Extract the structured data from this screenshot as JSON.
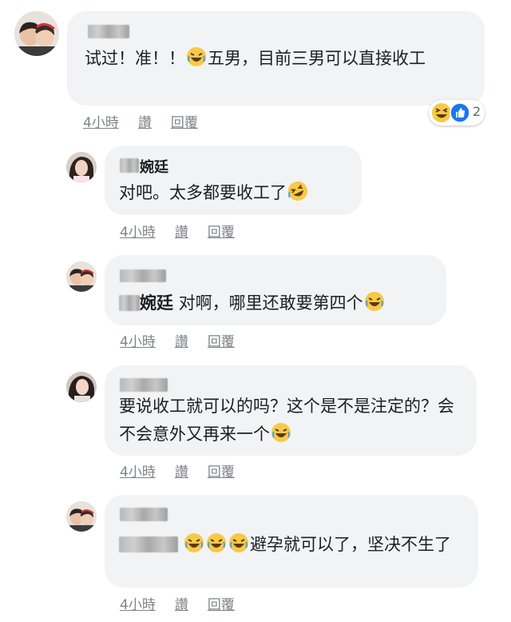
{
  "comments": [
    {
      "name_suffix": "",
      "text_a": "试过！准！！",
      "text_b": "五男，目前三男可以直接收工",
      "time": "4小時",
      "like": "讚",
      "reply": "回覆",
      "reaction_count": "2"
    },
    {
      "name_suffix": "婉廷",
      "text_a": "对吧。太多都要收工了",
      "time": "4小時",
      "like": "讚",
      "reply": "回覆"
    },
    {
      "name_suffix": "",
      "mention_suffix": "婉廷",
      "text_a": "对啊，哪里还敢要第四个",
      "time": "4小時",
      "like": "讚",
      "reply": "回覆"
    },
    {
      "name_suffix": "",
      "text_a": "要说收工就可以的吗？这个是不是注定的？会不会意外又再来一个",
      "time": "4小時",
      "like": "讚",
      "reply": "回覆"
    },
    {
      "name_suffix": "",
      "text_a": "避孕就可以了，坚决不生了",
      "time": "4小時",
      "like": "讚",
      "reply": "回覆"
    }
  ],
  "icons": {
    "laugh": "laughing-emoji",
    "rofl": "rofl-emoji",
    "squint": "squinting-laugh-emoji",
    "like": "like-thumb-icon"
  },
  "colors": {
    "bubble": "#f2f3f5",
    "like_blue": "#1877f2",
    "emoji_yellow": "#f7c948",
    "meta": "#7f8388"
  }
}
